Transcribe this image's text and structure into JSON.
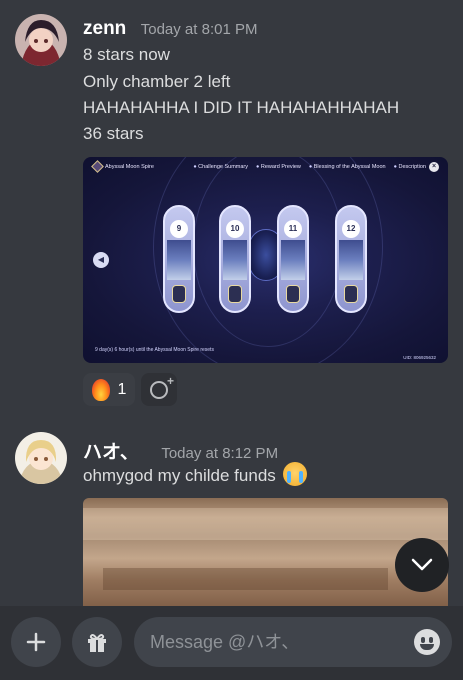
{
  "messages": [
    {
      "username": "zenn",
      "timestamp": "Today at 8:01 PM",
      "lines": [
        "8 stars now",
        "Only chamber 2 left",
        "HAHAHAHHA I DID IT HAHAHAHHAHAH",
        "36 stars"
      ],
      "attachment": {
        "game_title": "Abyssal Moon Spire",
        "game_tabs": [
          "Challenge Summary",
          "Reward Preview",
          "Blessing of the Abyssal Moon",
          "Description"
        ],
        "floors": [
          "9",
          "10",
          "11",
          "12"
        ],
        "reset_text": "9 day(s) 6 hour(s) until the Abyssal Moon Spire resets",
        "uid_text": "UID: 806925632"
      },
      "reactions": [
        {
          "emoji": "fire-emoji",
          "count": "1"
        }
      ]
    },
    {
      "username": "ハオ、",
      "timestamp": "Today at 8:12 PM",
      "text": "ohmygod my childe funds",
      "emoji": "loudly-crying-emoji"
    }
  ],
  "composer": {
    "placeholder": "Message @ハオ、"
  },
  "colors": {
    "background": "#36393f",
    "composer_bg": "#2f3136",
    "input_bg": "#40444b",
    "text": "#dcddde",
    "muted": "#a3a6aa"
  }
}
